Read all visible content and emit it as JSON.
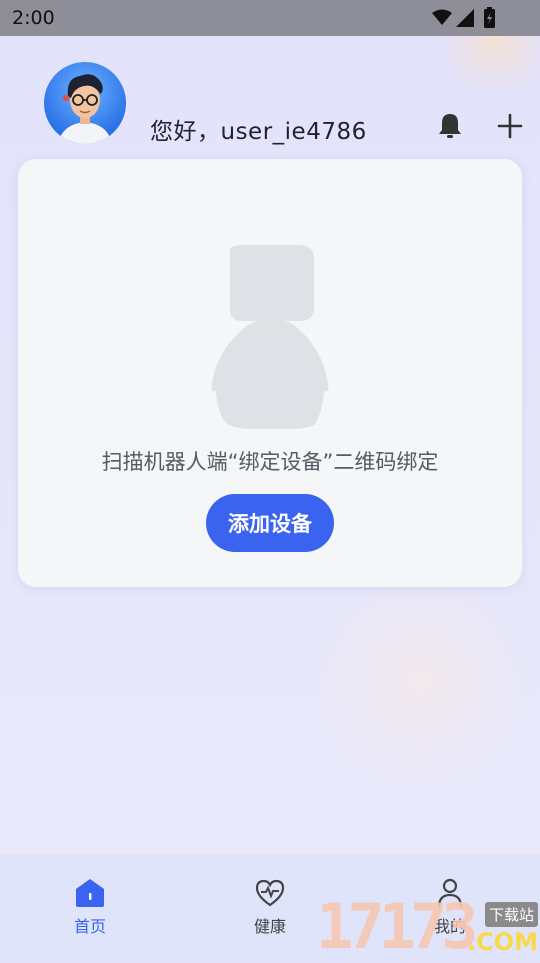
{
  "status_bar": {
    "time": "2:00"
  },
  "header": {
    "greeting": "您好，user_ie4786"
  },
  "device_card": {
    "description": "扫描机器人端“绑定设备”二维码绑定",
    "add_button_label": "添加设备"
  },
  "tabbar": {
    "items": [
      {
        "label": "首页",
        "icon": "home-icon",
        "active": true
      },
      {
        "label": "健康",
        "icon": "heart-pulse-icon",
        "active": false
      },
      {
        "label": "我的",
        "icon": "person-icon",
        "active": false
      }
    ]
  },
  "watermark": {
    "number": "17173",
    "badge": "下载站",
    "domain": ".COM"
  },
  "colors": {
    "accent": "#3a63f0",
    "card_bg": "#f5f6f8",
    "placeholder": "#dfe1e6"
  }
}
